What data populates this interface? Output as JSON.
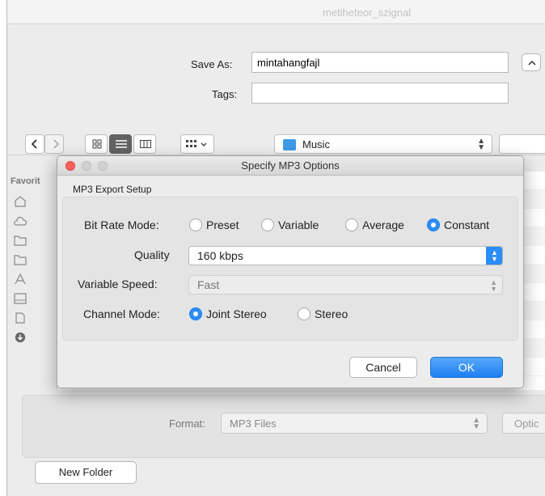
{
  "window": {
    "title": "metiheteor_szignal"
  },
  "save_as": {
    "label": "Save As:",
    "value": "mintahangfajl"
  },
  "tags": {
    "label": "Tags:",
    "value": ""
  },
  "toolbar": {
    "location": "Music"
  },
  "sidebar": {
    "header": "Favorit"
  },
  "format": {
    "label": "Format:",
    "value": "MP3 Files"
  },
  "options_button": "Optic",
  "new_folder_button": "New Folder",
  "dialog": {
    "title": "Specify MP3 Options",
    "section": "MP3 Export Setup",
    "bit_rate_mode": {
      "label": "Bit Rate Mode:",
      "options": [
        "Preset",
        "Variable",
        "Average",
        "Constant"
      ],
      "selected": "Constant"
    },
    "quality": {
      "label": "Quality",
      "value": "160 kbps"
    },
    "variable_speed": {
      "label": "Variable Speed:",
      "value": "Fast"
    },
    "channel_mode": {
      "label": "Channel Mode:",
      "options": [
        "Joint Stereo",
        "Stereo"
      ],
      "selected": "Joint Stereo"
    },
    "cancel_label": "Cancel",
    "ok_label": "OK",
    "accent_color": "#2b8ef6"
  }
}
